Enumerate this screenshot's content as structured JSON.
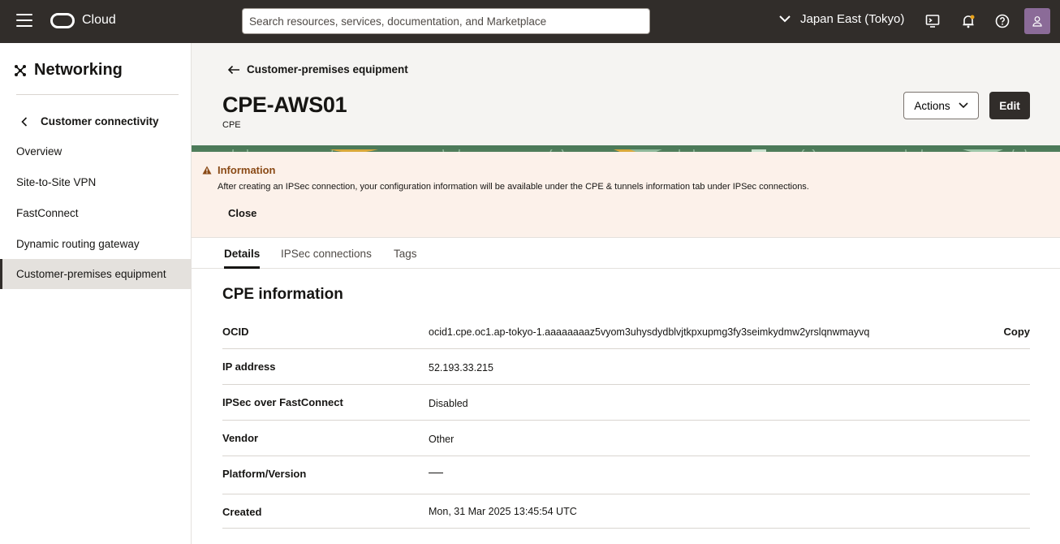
{
  "topbar": {
    "brand": "Cloud",
    "search_placeholder": "Search resources, services, documentation, and Marketplace",
    "region": "Japan East (Tokyo)",
    "icons": [
      "menu-icon",
      "cloud-shell-icon",
      "bell-icon",
      "help-icon",
      "user-icon"
    ]
  },
  "sidebar": {
    "title": "Networking",
    "back_label": "Customer connectivity",
    "items": [
      {
        "label": "Overview",
        "active": false
      },
      {
        "label": "Site-to-Site VPN",
        "active": false
      },
      {
        "label": "FastConnect",
        "active": false
      },
      {
        "label": "Dynamic routing gateway",
        "active": false
      },
      {
        "label": "Customer-premises equipment",
        "active": true
      }
    ]
  },
  "header": {
    "back_link": "Customer-premises equipment",
    "title": "CPE-AWS01",
    "subtitle": "CPE",
    "actions_label": "Actions",
    "edit_label": "Edit"
  },
  "notice": {
    "title": "Information",
    "text": "After creating an IPSec connection, your configuration information will be available under the CPE & tunnels information tab under IPSec connections.",
    "close_label": "Close"
  },
  "tabs": [
    {
      "label": "Details",
      "active": true
    },
    {
      "label": "IPSec connections",
      "active": false
    },
    {
      "label": "Tags",
      "active": false
    }
  ],
  "details": {
    "section_title": "CPE information",
    "copy_label": "Copy",
    "rows": [
      {
        "label": "OCID",
        "value": "ocid1.cpe.oc1.ap-tokyo-1.aaaaaaaaz5vyom3uhysdydblvjtkpxupmg3fy3seimkydmw2yrslqnwmayvq"
      },
      {
        "label": "IP address",
        "value": "52.193.33.215"
      },
      {
        "label": "IPSec over FastConnect",
        "value": "Disabled"
      },
      {
        "label": "Vendor",
        "value": "Other"
      },
      {
        "label": "Platform/Version",
        "value": ""
      },
      {
        "label": "Created",
        "value": "Mon, 31 Mar 2025 13:45:54 UTC"
      }
    ]
  },
  "colors": {
    "topbar": "#312d2a",
    "notice_bg": "#fcf1ea",
    "warning": "#8a4a16",
    "header_bg": "#f5f4f2"
  }
}
